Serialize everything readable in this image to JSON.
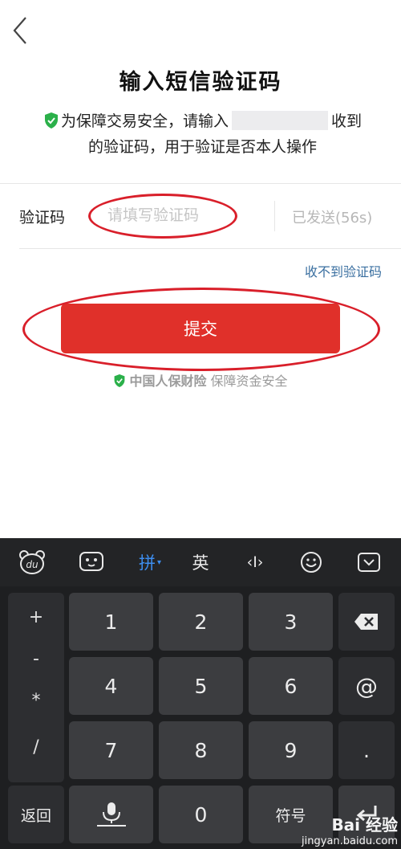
{
  "header": {
    "back_icon": "chevron-left-icon"
  },
  "title": "输入短信验证码",
  "notice": {
    "prefix": "为保障交易安全，请输入",
    "suffix": "收到",
    "line2": "的验证码，用于验证是否本人操作"
  },
  "code_field": {
    "label": "验证码",
    "placeholder": "请填写验证码",
    "value": "",
    "sent_status": "已发送(56s)"
  },
  "resend_link": "收不到验证码",
  "submit_label": "提交",
  "security": {
    "brand": "中国人保财险",
    "text": "保障资金安全"
  },
  "keyboard": {
    "toolbar": {
      "pinyin": "拼",
      "english": "英",
      "cursor": "‹I›"
    },
    "symbols": [
      "+",
      "-",
      "*",
      "/"
    ],
    "keys": [
      "1",
      "2",
      "3",
      "4",
      "5",
      "6",
      "7",
      "8",
      "9",
      "0"
    ],
    "at": "@",
    "dot": ".",
    "back": "返回",
    "symbol": "符号"
  },
  "watermark": {
    "main": "Bai 经验",
    "sub": "jingyan.baidu.com"
  },
  "colors": {
    "accent": "#e0302a",
    "link": "#3a6fa0",
    "shield": "#2bb04a",
    "annotation": "#d91f2a"
  }
}
